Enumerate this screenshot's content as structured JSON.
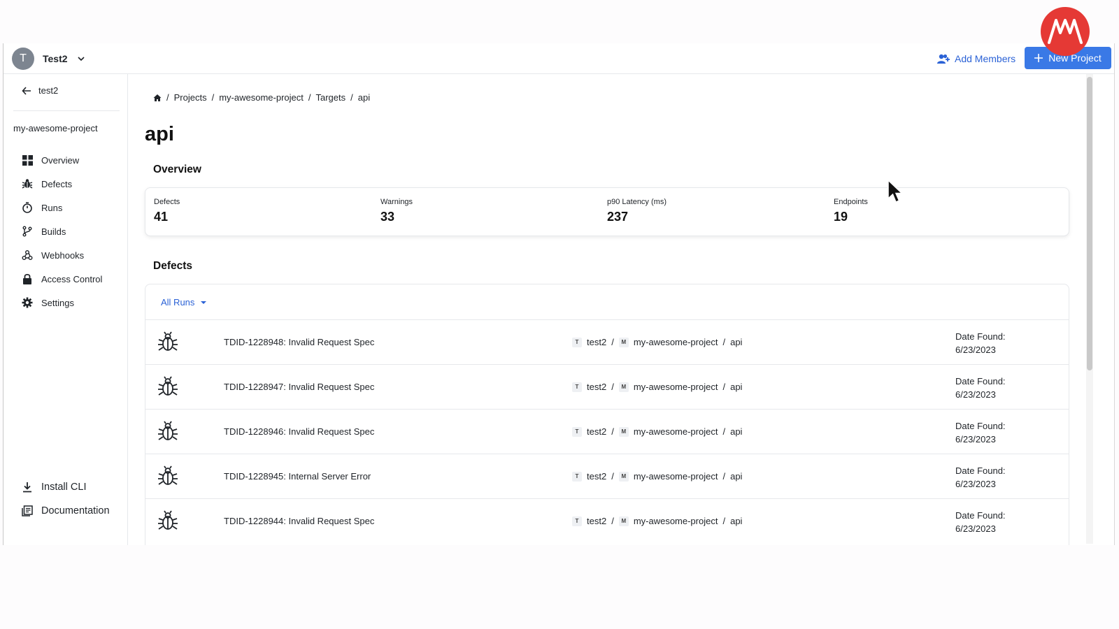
{
  "topbar": {
    "org_initial": "T",
    "org_name": "Test2",
    "add_members_label": "Add Members",
    "new_project_label": "New Project"
  },
  "sidebar": {
    "back_label": "test2",
    "project_name": "my-awesome-project",
    "items": [
      {
        "label": "Overview",
        "icon": "grid-icon"
      },
      {
        "label": "Defects",
        "icon": "bug-icon"
      },
      {
        "label": "Runs",
        "icon": "stopwatch-icon"
      },
      {
        "label": "Builds",
        "icon": "git-branch-icon"
      },
      {
        "label": "Webhooks",
        "icon": "webhook-icon"
      },
      {
        "label": "Access Control",
        "icon": "lock-icon"
      },
      {
        "label": "Settings",
        "icon": "gear-icon"
      }
    ],
    "bottom_items": [
      {
        "label": "Install CLI",
        "icon": "download-icon"
      },
      {
        "label": "Documentation",
        "icon": "docs-icon"
      }
    ]
  },
  "breadcrumb": [
    "Projects",
    "my-awesome-project",
    "Targets",
    "api"
  ],
  "page_title": "api",
  "overview": {
    "title": "Overview",
    "stats": [
      {
        "label": "Defects",
        "value": "41"
      },
      {
        "label": "Warnings",
        "value": "33"
      },
      {
        "label": "p90 Latency (ms)",
        "value": "237"
      },
      {
        "label": "Endpoints",
        "value": "19"
      }
    ]
  },
  "defects": {
    "title": "Defects",
    "filter_label": "All Runs",
    "rows": [
      {
        "title": "TDID-1228948: Invalid Request Spec",
        "org": "test2",
        "project": "my-awesome-project",
        "target": "api",
        "date_label": "Date Found:",
        "date": "6/23/2023"
      },
      {
        "title": "TDID-1228947: Invalid Request Spec",
        "org": "test2",
        "project": "my-awesome-project",
        "target": "api",
        "date_label": "Date Found:",
        "date": "6/23/2023"
      },
      {
        "title": "TDID-1228946: Invalid Request Spec",
        "org": "test2",
        "project": "my-awesome-project",
        "target": "api",
        "date_label": "Date Found:",
        "date": "6/23/2023"
      },
      {
        "title": "TDID-1228945: Internal Server Error",
        "org": "test2",
        "project": "my-awesome-project",
        "target": "api",
        "date_label": "Date Found:",
        "date": "6/23/2023"
      },
      {
        "title": "TDID-1228944: Invalid Request Spec",
        "org": "test2",
        "project": "my-awesome-project",
        "target": "api",
        "date_label": "Date Found:",
        "date": "6/23/2023"
      }
    ],
    "chip_org": "T",
    "chip_project": "M"
  },
  "colors": {
    "accent": "#3a79e6",
    "link": "#2b62d6",
    "logo": "#e53935"
  }
}
